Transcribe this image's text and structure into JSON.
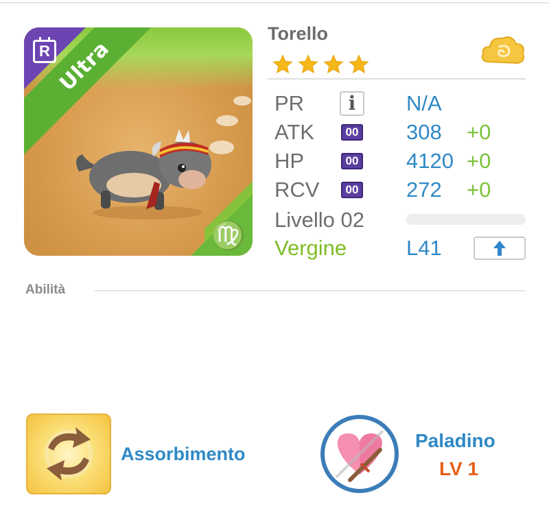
{
  "monster": {
    "name": "Torello",
    "stars": 4,
    "rarity_ribbon": "Ultra",
    "rarity_badge": "R",
    "zodiac_glyph": "♍",
    "element_icon": "cloud-element-icon"
  },
  "stats": {
    "pr": {
      "label": "PR",
      "value": "N/A"
    },
    "atk": {
      "label": "ATK",
      "badge": "00",
      "value": "308",
      "plus": "+0"
    },
    "hp": {
      "label": "HP",
      "badge": "00",
      "value": "4120",
      "plus": "+0"
    },
    "rcv": {
      "label": "RCV",
      "badge": "00",
      "value": "272",
      "plus": "+0"
    },
    "level": {
      "label": "Livello 02",
      "progress": 0
    },
    "sign": {
      "label": "Vergine",
      "max_level": "L41"
    }
  },
  "abilities": {
    "heading": "Abilità",
    "skill_name": "Assorbimento",
    "leader_name": "Paladino",
    "leader_level": "LV 1"
  },
  "colors": {
    "accent_blue": "#2f89c6",
    "accent_green": "#7cc23a",
    "ultra_green": "#5bb033",
    "rarity_purple": "#6c45b3",
    "level_orange": "#e8601c"
  }
}
